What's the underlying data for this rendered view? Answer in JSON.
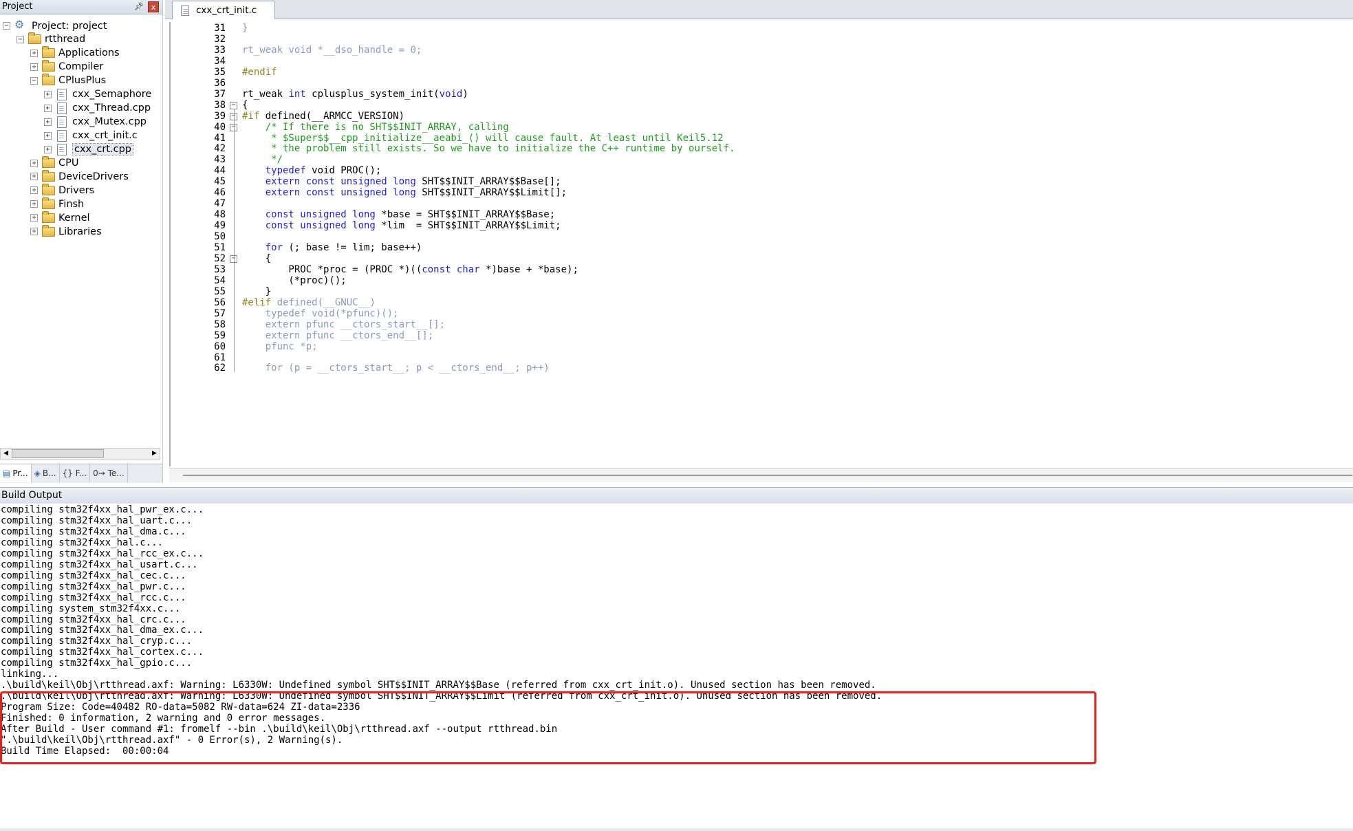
{
  "project_panel": {
    "title": "Project",
    "pin_glyph": "⌂",
    "close_glyph": "x",
    "tree": [
      {
        "label": "Project: project",
        "expanded": true,
        "kind": "project"
      },
      {
        "label": "rtthread",
        "expanded": true,
        "kind": "folder"
      },
      {
        "label": "Applications",
        "expanded": false,
        "kind": "folder"
      },
      {
        "label": "Compiler",
        "expanded": false,
        "kind": "folder"
      },
      {
        "label": "CPlusPlus",
        "expanded": true,
        "kind": "folder"
      },
      {
        "label": "cxx_Semaphore",
        "expanded": false,
        "kind": "file"
      },
      {
        "label": "cxx_Thread.cpp",
        "expanded": false,
        "kind": "file"
      },
      {
        "label": "cxx_Mutex.cpp",
        "expanded": false,
        "kind": "file"
      },
      {
        "label": "cxx_crt_init.c",
        "expanded": false,
        "kind": "file"
      },
      {
        "label": "cxx_crt.cpp",
        "expanded": false,
        "kind": "file",
        "selected": true
      },
      {
        "label": "CPU",
        "expanded": false,
        "kind": "folder"
      },
      {
        "label": "DeviceDrivers",
        "expanded": false,
        "kind": "folder"
      },
      {
        "label": "Drivers",
        "expanded": false,
        "kind": "folder"
      },
      {
        "label": "Finsh",
        "expanded": false,
        "kind": "folder"
      },
      {
        "label": "Kernel",
        "expanded": false,
        "kind": "folder"
      },
      {
        "label": "Libraries",
        "expanded": false,
        "kind": "folder"
      }
    ],
    "tabs": [
      {
        "label": "Pr...",
        "icon": "project-icon",
        "active": true
      },
      {
        "label": "B...",
        "icon": "books-icon",
        "active": false
      },
      {
        "label": "{} F...",
        "icon": "functions-icon",
        "active": false
      },
      {
        "label": "0→ Te...",
        "icon": "templates-icon",
        "active": false
      }
    ]
  },
  "editor": {
    "tab_label": "cxx_crt_init.c",
    "lines": [
      {
        "n": "31",
        "tokens": [
          {
            "t": "}",
            "c": "gy"
          }
        ]
      },
      {
        "n": "32",
        "tokens": []
      },
      {
        "n": "33",
        "tokens": [
          {
            "t": "rt_weak ",
            "c": "gy"
          },
          {
            "t": "void",
            "c": "gy"
          },
          {
            "t": " *__dso_handle = 0;",
            "c": "gy"
          }
        ]
      },
      {
        "n": "34",
        "tokens": []
      },
      {
        "n": "35",
        "tokens": [
          {
            "t": "#endif",
            "c": "pp"
          }
        ]
      },
      {
        "n": "36",
        "tokens": []
      },
      {
        "n": "37",
        "tokens": [
          {
            "t": "rt_weak ",
            "c": ""
          },
          {
            "t": "int",
            "c": "kw"
          },
          {
            "t": " cplusplus_system_init(",
            "c": ""
          },
          {
            "t": "void",
            "c": "kw"
          },
          {
            "t": ")",
            "c": ""
          }
        ]
      },
      {
        "n": "38",
        "fold": "-",
        "tokens": [
          {
            "t": "{",
            "c": ""
          }
        ]
      },
      {
        "n": "39",
        "fold": "-",
        "tokens": [
          {
            "t": "#if",
            "c": "pp"
          },
          {
            "t": " defined(__ARMCC_VERSION)",
            "c": ""
          }
        ]
      },
      {
        "n": "40",
        "fold": "-",
        "tokens": [
          {
            "t": "    /* If there is no SHT$$INIT_ARRAY, calling",
            "c": "cm"
          }
        ]
      },
      {
        "n": "41",
        "tokens": [
          {
            "t": "     * $Super$$__cpp_initialize__aeabi_() will cause fault. At least until Keil5.12",
            "c": "cm"
          }
        ]
      },
      {
        "n": "42",
        "tokens": [
          {
            "t": "     * the problem still exists. So we have to initialize the C++ runtime by ourself.",
            "c": "cm"
          }
        ]
      },
      {
        "n": "43",
        "tokens": [
          {
            "t": "     */",
            "c": "cm"
          }
        ]
      },
      {
        "n": "44",
        "tokens": [
          {
            "t": "    ",
            "c": ""
          },
          {
            "t": "typedef",
            "c": "kw"
          },
          {
            "t": " void PROC();",
            "c": ""
          }
        ]
      },
      {
        "n": "45",
        "tokens": [
          {
            "t": "    ",
            "c": ""
          },
          {
            "t": "extern const unsigned long",
            "c": "kw"
          },
          {
            "t": " SHT$$INIT_ARRAY$$Base[];",
            "c": ""
          }
        ]
      },
      {
        "n": "46",
        "tokens": [
          {
            "t": "    ",
            "c": ""
          },
          {
            "t": "extern const unsigned long",
            "c": "kw"
          },
          {
            "t": " SHT$$INIT_ARRAY$$Limit[];",
            "c": ""
          }
        ]
      },
      {
        "n": "47",
        "tokens": []
      },
      {
        "n": "48",
        "tokens": [
          {
            "t": "    ",
            "c": ""
          },
          {
            "t": "const unsigned long",
            "c": "kw"
          },
          {
            "t": " *base = SHT$$INIT_ARRAY$$Base;",
            "c": ""
          }
        ]
      },
      {
        "n": "49",
        "tokens": [
          {
            "t": "    ",
            "c": ""
          },
          {
            "t": "const unsigned long",
            "c": "kw"
          },
          {
            "t": " *lim  = SHT$$INIT_ARRAY$$Limit;",
            "c": ""
          }
        ]
      },
      {
        "n": "50",
        "tokens": []
      },
      {
        "n": "51",
        "tokens": [
          {
            "t": "    ",
            "c": ""
          },
          {
            "t": "for",
            "c": "kw"
          },
          {
            "t": " (; base != lim; base++)",
            "c": ""
          }
        ]
      },
      {
        "n": "52",
        "fold": "-",
        "tokens": [
          {
            "t": "    {",
            "c": ""
          }
        ]
      },
      {
        "n": "53",
        "tokens": [
          {
            "t": "        PROC *proc = (PROC *)((",
            "c": ""
          },
          {
            "t": "const char",
            "c": "kw"
          },
          {
            "t": " *)base + *base);",
            "c": ""
          }
        ]
      },
      {
        "n": "54",
        "tokens": [
          {
            "t": "        (*proc)();",
            "c": ""
          }
        ]
      },
      {
        "n": "55",
        "tokens": [
          {
            "t": "    }",
            "c": ""
          }
        ]
      },
      {
        "n": "56",
        "tokens": [
          {
            "t": "#elif",
            "c": "pp"
          },
          {
            "t": " defined(__GNUC__)",
            "c": "gy"
          }
        ]
      },
      {
        "n": "57",
        "tokens": [
          {
            "t": "    typedef void(*pfunc)();",
            "c": "gy"
          }
        ]
      },
      {
        "n": "58",
        "tokens": [
          {
            "t": "    extern pfunc __ctors_start__[];",
            "c": "gy"
          }
        ]
      },
      {
        "n": "59",
        "tokens": [
          {
            "t": "    extern pfunc __ctors_end__[];",
            "c": "gy"
          }
        ]
      },
      {
        "n": "60",
        "tokens": [
          {
            "t": "    pfunc *p;",
            "c": "gy"
          }
        ]
      },
      {
        "n": "61",
        "tokens": []
      },
      {
        "n": "62",
        "tokens": [
          {
            "t": "    for (p = __ctors_start__; p < __ctors_end__; p++)",
            "c": "gy"
          }
        ]
      }
    ]
  },
  "build_output": {
    "title": "Build Output",
    "lines": [
      "compiling stm32f4xx_hal_pwr_ex.c...",
      "compiling stm32f4xx_hal_uart.c...",
      "compiling stm32f4xx_hal_dma.c...",
      "compiling stm32f4xx_hal.c...",
      "compiling stm32f4xx_hal_rcc_ex.c...",
      "compiling stm32f4xx_hal_usart.c...",
      "compiling stm32f4xx_hal_cec.c...",
      "compiling stm32f4xx_hal_pwr.c...",
      "compiling stm32f4xx_hal_rcc.c...",
      "compiling system_stm32f4xx.c...",
      "compiling stm32f4xx_hal_crc.c...",
      "compiling stm32f4xx_hal_dma_ex.c...",
      "compiling stm32f4xx_hal_cryp.c...",
      "compiling stm32f4xx_hal_cortex.c...",
      "compiling stm32f4xx_hal_gpio.c...",
      "linking...",
      ".\\build\\keil\\Obj\\rtthread.axf: Warning: L6330W: Undefined symbol SHT$$INIT_ARRAY$$Base (referred from cxx_crt_init.o). Unused section has been removed.",
      ".\\build\\keil\\Obj\\rtthread.axf: Warning: L6330W: Undefined symbol SHT$$INIT_ARRAY$$Limit (referred from cxx_crt_init.o). Unused section has been removed.",
      "Program Size: Code=40482 RO-data=5082 RW-data=624 ZI-data=2336",
      "Finished: 0 information, 2 warning and 0 error messages.",
      "After Build - User command #1: fromelf --bin .\\build\\keil\\Obj\\rtthread.axf --output rtthread.bin",
      "\".\\build\\keil\\Obj\\rtthread.axf\" - 0 Error(s), 2 Warning(s).",
      "Build Time Elapsed:  00:00:04"
    ]
  },
  "colors": {
    "keyword": "#1f1fe0",
    "comment": "#1f9a1f",
    "preprocessor": "#8a8a1a",
    "inactive_code": "#8a9ac0",
    "highlight_box": "#e8201c"
  }
}
